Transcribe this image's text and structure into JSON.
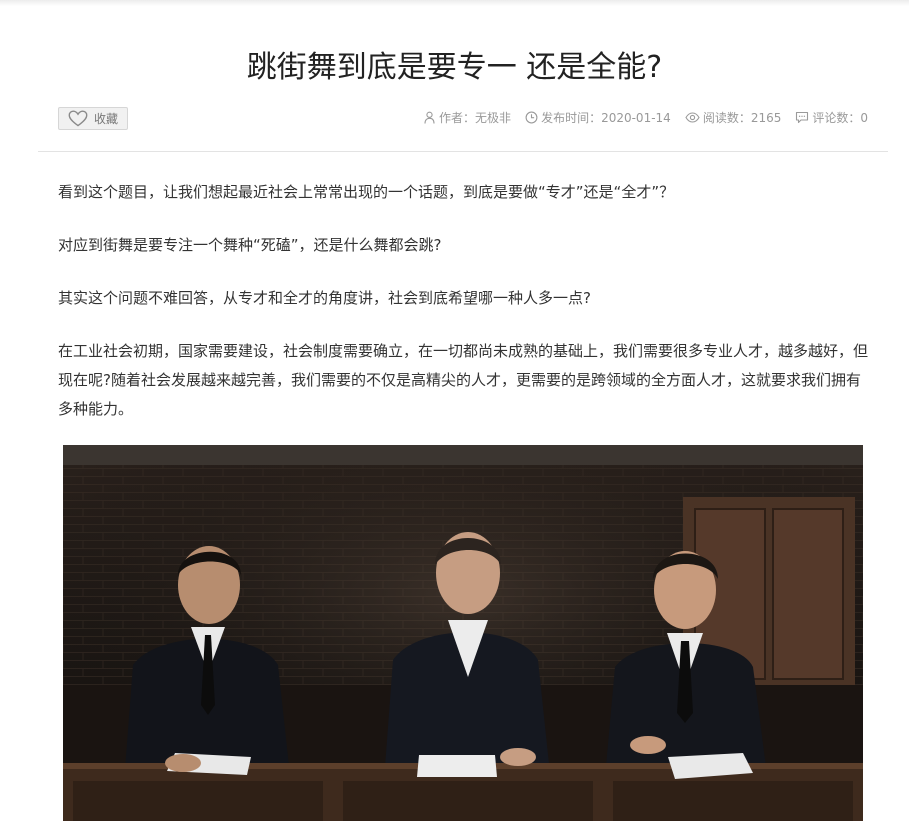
{
  "article": {
    "title": "跳街舞到底是要专一 还是全能?",
    "favorite_label": "收藏",
    "meta": {
      "author": "作者：无极非",
      "publish_time": "发布时间：2020-01-14",
      "reads": "阅读数：2165",
      "comments": "评论数：0"
    },
    "paragraphs": [
      "看到这个题目，让我们想起最近社会上常常出现的一个话题，到底是要做“专才”还是“全才”？",
      "对应到街舞是要专注一个舞种“死磕”，还是什么舞都会跳?",
      "其实这个问题不难回答，从专才和全才的角度讲，社会到底希望哪一种人多一点?",
      "在工业社会初期，国家需要建设，社会制度需要确立，在一切都尚未成熟的基础上，我们需要很多专业人才，越多越好，但现在呢?随着社会发展越来越完善，我们需要的不仅是高精尖的人才，更需要的是跨领域的全方面人才，这就要求我们拥有多种能力。"
    ]
  },
  "icons": {
    "favorite": "heart-icon",
    "author": "user-icon",
    "time": "clock-icon",
    "reads": "eye-icon",
    "comments": "comment-icon"
  },
  "colors": {
    "title": "#222222",
    "text": "#333333",
    "meta": "#999999",
    "button_bg": "#f1f1f1",
    "divider": "#e3e3e3"
  }
}
